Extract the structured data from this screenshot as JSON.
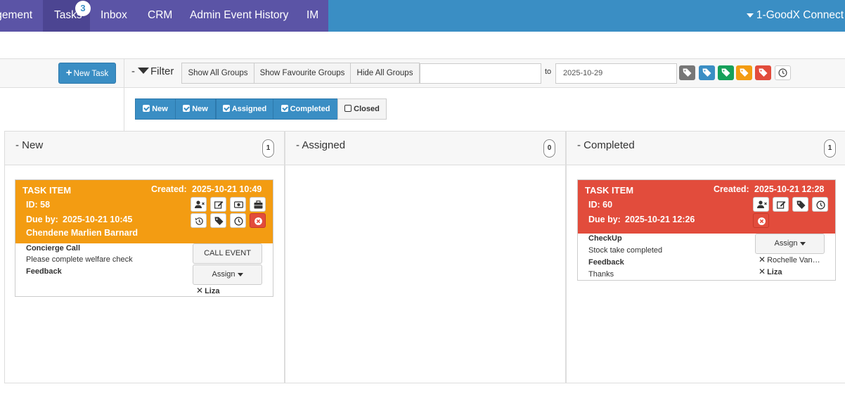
{
  "nav": {
    "items": [
      "gement",
      "Tasks",
      "Inbox",
      "CRM",
      "Admin Event History",
      "IM"
    ],
    "tasks_badge": "3",
    "connect": "1-GoodX Connect"
  },
  "toolbar": {
    "new_task": "New Task",
    "filter": "Filter",
    "filter_prefix": "-",
    "show_all_groups": "Show All Groups",
    "show_favourite_groups": "Show Favourite Groups",
    "hide_all_groups": "Hide All Groups",
    "date_from": "",
    "to_label": "to",
    "date_to": "2025-10-29",
    "tag_colors": [
      "#777777",
      "#3a8ec4",
      "#16a05a",
      "#f39c12",
      "#e24c3c"
    ]
  },
  "statuses": [
    {
      "label": "New",
      "checked": true
    },
    {
      "label": "New",
      "checked": true
    },
    {
      "label": "Assigned",
      "checked": true
    },
    {
      "label": "Completed",
      "checked": true
    },
    {
      "label": "Closed",
      "checked": false
    }
  ],
  "columns": [
    {
      "title": "New",
      "count": "1"
    },
    {
      "title": "Assigned",
      "count": "0"
    },
    {
      "title": "Completed",
      "count": "1"
    }
  ],
  "cards": {
    "new": {
      "color": "#f39c12",
      "title": "TASK ITEM",
      "created_label": "Created:",
      "created": "2025-10-21 10:49",
      "id": "ID: 58",
      "due_label": "Due by:",
      "due": "2025-10-21 10:45",
      "person": "Chendene Marlien Barnard",
      "heading": "Concierge Call",
      "description": "Please complete welfare check",
      "feedback_label": "Feedback",
      "call_event": "CALL EVENT",
      "assign": "Assign",
      "assignees": [
        "Liza"
      ]
    },
    "completed": {
      "color": "#e24c3c",
      "title": "TASK ITEM",
      "created_label": "Created:",
      "created": "2025-10-21 12:28",
      "id": "ID: 60",
      "due_label": "Due by:",
      "due": "2025-10-21 12:26",
      "heading": "CheckUp",
      "description": "Stock take completed",
      "feedback_label": "Feedback",
      "feedback": "Thanks",
      "assign": "Assign",
      "assignees": [
        "Rochelle Van…",
        "Liza"
      ]
    }
  }
}
